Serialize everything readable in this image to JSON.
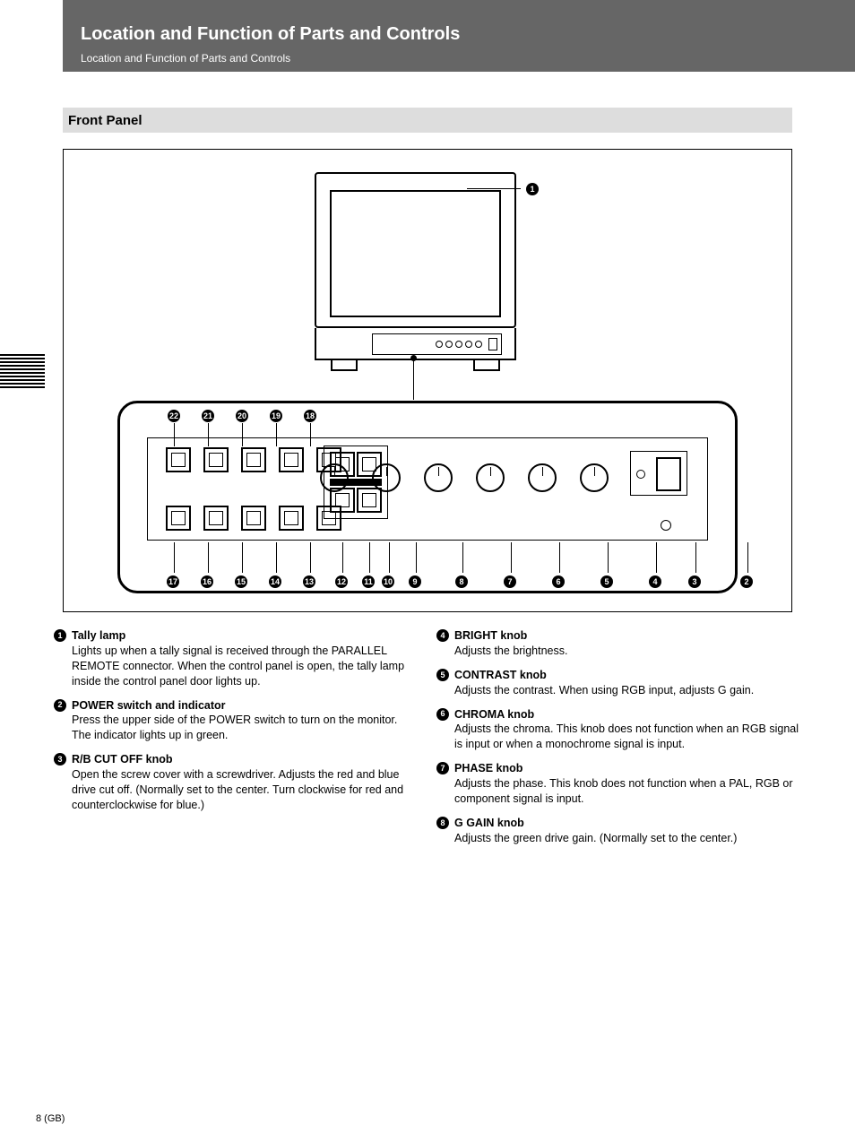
{
  "page_number": "8 (GB)",
  "header": {
    "title": "Location and Function of Parts and Controls",
    "subtitle": "Location and Function of Parts and Controls"
  },
  "section": "Front Panel",
  "figure": {
    "callouts_top": [
      "22",
      "21",
      "20",
      "19",
      "18"
    ],
    "callouts_bottom": [
      "17",
      "16",
      "15",
      "14",
      "13",
      "12",
      "11",
      "10",
      "9",
      "8",
      "7",
      "6",
      "5",
      "4",
      "3",
      "2"
    ],
    "monitor_callout": "1"
  },
  "descriptions_left": [
    {
      "n": "1",
      "title": "Tally lamp",
      "body": "Lights up when a tally signal is received through the PARALLEL REMOTE connector. When the control panel is open, the tally lamp inside the control panel door lights up."
    },
    {
      "n": "2",
      "title": "POWER switch and indicator",
      "body": "Press the upper side of the POWER switch to turn on the monitor. The indicator lights up in green."
    },
    {
      "n": "3",
      "title": "R/B CUT OFF knob",
      "body": "Open the screw cover with a screwdriver. Adjusts the red and blue drive cut off. (Normally set to the center. Turn clockwise for red and counterclockwise for blue.)"
    }
  ],
  "descriptions_right": [
    {
      "n": "4",
      "title": "BRIGHT knob",
      "body": "Adjusts the brightness."
    },
    {
      "n": "5",
      "title": "CONTRAST knob",
      "body": "Adjusts the contrast. When using RGB input, adjusts G gain."
    },
    {
      "n": "6",
      "title": "CHROMA knob",
      "body": "Adjusts the chroma. This knob does not function when an RGB signal is input or when a monochrome signal is input."
    },
    {
      "n": "7",
      "title": "PHASE knob",
      "body": "Adjusts the phase. This knob does not function when a PAL, RGB or component signal is input."
    },
    {
      "n": "8",
      "title": "G GAIN knob",
      "body": "Adjusts the green drive gain. (Normally set to the center.)"
    }
  ]
}
